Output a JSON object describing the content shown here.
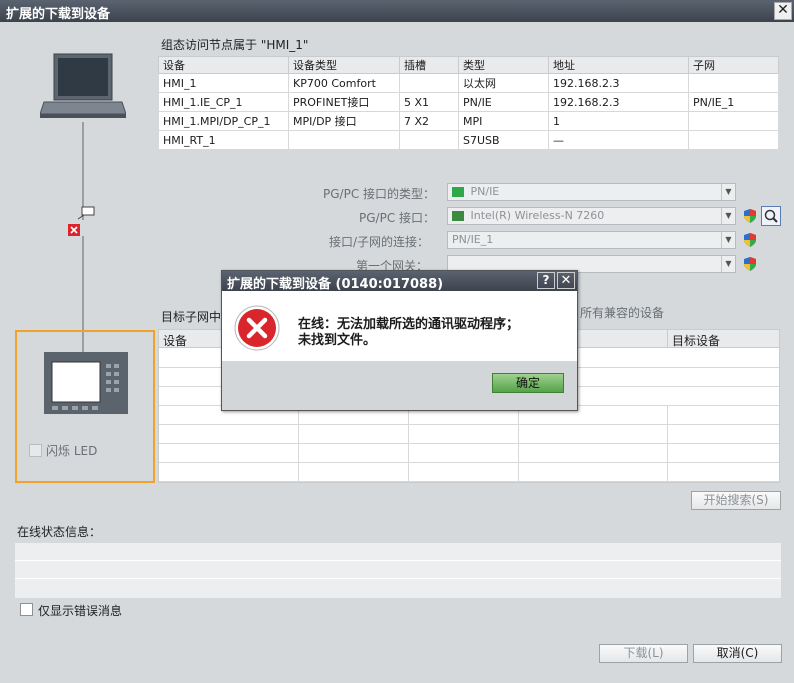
{
  "window": {
    "title": "扩展的下载到设备",
    "close_glyph": "✕"
  },
  "nodes_section": {
    "caption": "组态访问节点属于 \"HMI_1\"",
    "columns": [
      "设备",
      "设备类型",
      "插槽",
      "类型",
      "地址",
      "子网"
    ],
    "rows": [
      [
        "HMI_1",
        "KP700 Comfort",
        "",
        "以太网",
        "192.168.2.3",
        ""
      ],
      [
        "HMI_1.IE_CP_1",
        "PROFINET接口",
        "5 X1",
        "PN/IE",
        "192.168.2.3",
        "PN/IE_1"
      ],
      [
        "HMI_1.MPI/DP_CP_1",
        "MPI/DP 接口",
        "7 X2",
        "MPI",
        "1",
        ""
      ],
      [
        "HMI_RT_1",
        "",
        "",
        "S7USB",
        "—",
        ""
      ]
    ]
  },
  "interface": {
    "type_label": "PG/PC 接口的类型：",
    "type_value": "PN/IE",
    "iface_label": "PG/PC 接口：",
    "iface_value": "Intel(R) Wireless-N 7260",
    "subnet_label": "接口/子网的连接：",
    "subnet_value": "PN/IE_1",
    "gateway_label": "第一个网关：",
    "gateway_value": ""
  },
  "target_section": {
    "caption": "目标子网中",
    "show_all": "所有兼容的设备",
    "columns": [
      "设备",
      "目标设备"
    ],
    "empty_rows": 7
  },
  "left_panel": {
    "flash_led": "闪烁 LED"
  },
  "buttons": {
    "start_search": "开始搜索(S)",
    "load": "下载(L)",
    "cancel": "取消(C)"
  },
  "status": {
    "caption": "在线状态信息：",
    "only_errors": "仅显示错误消息"
  },
  "dialog": {
    "title": "扩展的下载到设备 (0140:017088)",
    "help_glyph": "?",
    "close_glyph": "✕",
    "message_line1": "在线：无法加载所选的通讯驱动程序；",
    "message_line2": "未找到文件。",
    "ok": "确定"
  },
  "colors": {
    "accent_orange": "#f4a12a",
    "error_red": "#d9262c",
    "ok_green": "#55a349"
  }
}
